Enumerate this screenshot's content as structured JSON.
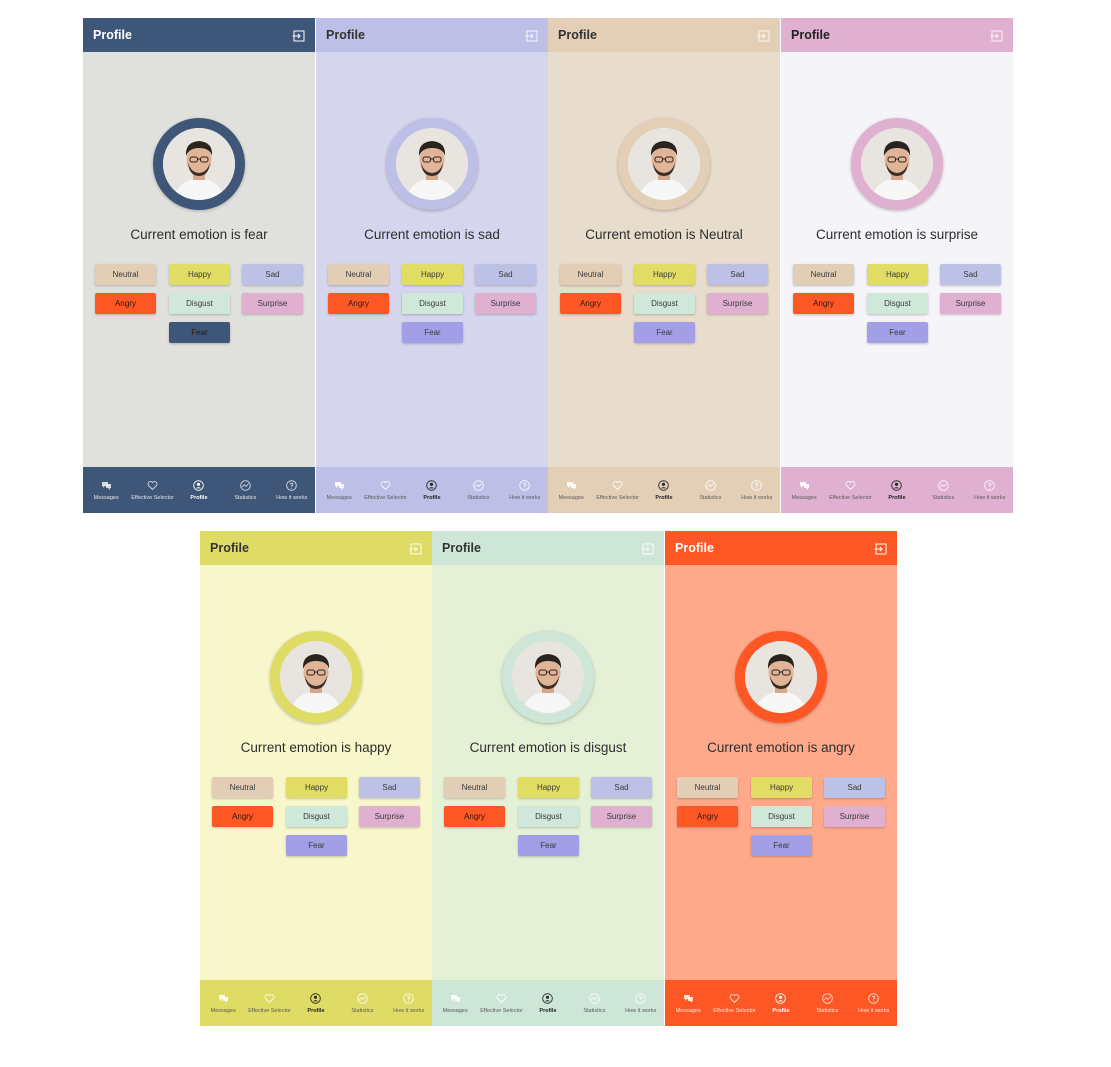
{
  "app": {
    "title": "Profile",
    "emotion_prefix": "Current emotion is",
    "emotion_buttons": {
      "neutral": "Neutral",
      "happy": "Happy",
      "sad": "Sad",
      "angry": "Angry",
      "disgust": "Disgust",
      "surprise": "Surprise",
      "fear": "Fear"
    },
    "button_colors": {
      "neutral": "#e2cdb5",
      "happy": "#e1dd64",
      "sad": "#bec1e6",
      "angry": "#fd5725",
      "disgust": "#cfe8d9",
      "surprise": "#e0b0d1",
      "fear": "#a39fe6"
    },
    "nav": {
      "messages": "Messages",
      "selector": "Effective Selector",
      "profile": "Profile",
      "statistics": "Statistics",
      "how": "How it works"
    },
    "icons": [
      "chat-icon",
      "heart-icon",
      "profile-icon",
      "statistics-icon",
      "help-icon",
      "logout-icon"
    ]
  },
  "screens": [
    {
      "emotion": "fear",
      "label": "Current emotion is fear",
      "bar": "#3e5677",
      "bg": "#e0e0dd",
      "ring": "#3e5677",
      "title_color": "#ffffff",
      "fear_btn": "#3e5677"
    },
    {
      "emotion": "sad",
      "label": "Current emotion is sad",
      "bar": "#bdbfe6",
      "bg": "#d5d6ee",
      "ring": "#bdbfe6",
      "title_color": "#333333",
      "fear_btn": "#a39fe6"
    },
    {
      "emotion": "Neutral",
      "label": "Current emotion is Neutral",
      "bar": "#e2cfb5",
      "bg": "#e8dccc",
      "ring": "#e2cfb5",
      "title_color": "#333333",
      "fear_btn": "#a39fe6"
    },
    {
      "emotion": "surprise",
      "label": "Current emotion is surprise",
      "bar": "#e0b0d1",
      "bg": "#f4f4f9",
      "ring": "#e0b0d1",
      "title_color": "#222222",
      "fear_btn": "#a39fe6"
    },
    {
      "emotion": "happy",
      "label": "Current emotion is happy",
      "bar": "#dfdc66",
      "bg": "#f8f7cb",
      "ring": "#dfdc66",
      "title_color": "#333333",
      "fear_btn": "#a39fe6"
    },
    {
      "emotion": "disgust",
      "label": "Current emotion is disgust",
      "bar": "#cee6d7",
      "bg": "#e4f1d7",
      "ring": "#cee6d7",
      "title_color": "#333333",
      "fear_btn": "#a39fe6"
    },
    {
      "emotion": "angry",
      "label": "Current emotion is angry",
      "bar": "#fd5725",
      "bg": "#ffa98a",
      "ring": "#fd5725",
      "title_color": "#ffffff",
      "fear_btn": "#a39fe6"
    }
  ]
}
